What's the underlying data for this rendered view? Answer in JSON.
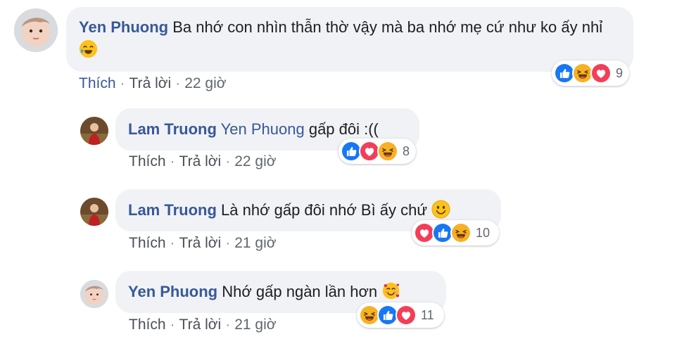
{
  "comments": [
    {
      "author": "Yen Phuong",
      "text": "Ba nhớ con nhìn thẫn thờ vậy mà ba nhớ mẹ cứ như ko ấy nhỉ",
      "emoji": "crying-laughing-face-icon",
      "like": "Thích",
      "reply": "Trả lời",
      "time": "22 giờ",
      "reactions": [
        "like-reaction-icon",
        "haha-reaction-icon",
        "love-reaction-icon"
      ],
      "reaction_count": "9"
    },
    {
      "author": "Lam Truong",
      "mention": "Yen Phuong",
      "text": "gấp đôi :((",
      "like": "Thích",
      "reply": "Trả lời",
      "time": "22 giờ",
      "reactions": [
        "like-reaction-icon",
        "love-reaction-icon",
        "haha-reaction-icon"
      ],
      "reaction_count": "8"
    },
    {
      "author": "Lam Truong",
      "text": "Là nhớ gấp đôi nhớ Bì ấy chứ",
      "emoji": "smiling-face-icon",
      "like": "Thích",
      "reply": "Trả lời",
      "time": "21 giờ",
      "reactions": [
        "love-reaction-icon",
        "like-reaction-icon",
        "haha-reaction-icon"
      ],
      "reaction_count": "10"
    },
    {
      "author": "Yen Phuong",
      "text": "Nhớ gấp ngàn lần hơn",
      "emoji": "smiling-face-with-hearts-icon",
      "like": "Thích",
      "reply": "Trả lời",
      "time": "21 giờ",
      "reactions": [
        "haha-reaction-icon",
        "like-reaction-icon",
        "love-reaction-icon"
      ],
      "reaction_count": "11"
    }
  ],
  "colors": {
    "author": "#385898",
    "bubble": "#f0f2f5",
    "like_reaction": "#1877f2",
    "love_reaction": "#f33e58",
    "haha_reaction": "#f7b125"
  }
}
